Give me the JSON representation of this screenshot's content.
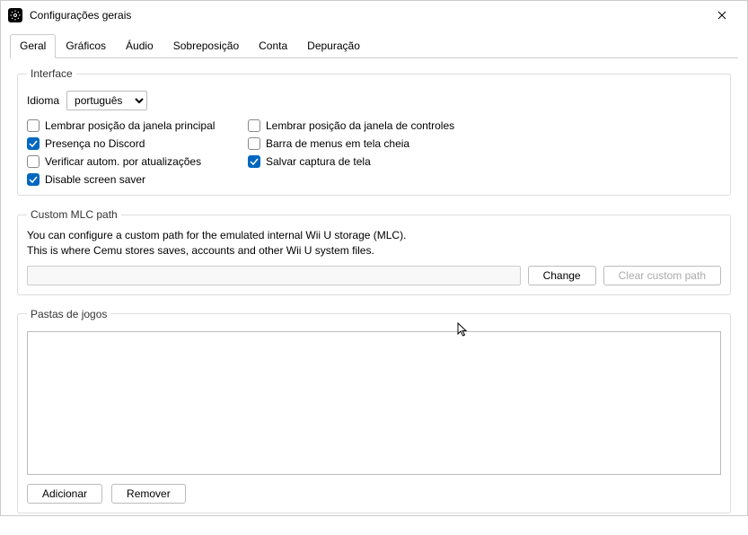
{
  "window": {
    "title": "Configurações gerais"
  },
  "tabs": {
    "items": [
      {
        "label": "Geral",
        "active": true
      },
      {
        "label": "Gráficos",
        "active": false
      },
      {
        "label": "Áudio",
        "active": false
      },
      {
        "label": "Sobreposição",
        "active": false
      },
      {
        "label": "Conta",
        "active": false
      },
      {
        "label": "Depuração",
        "active": false
      }
    ]
  },
  "interface": {
    "legend": "Interface",
    "language_label": "Idioma",
    "language_value": "português",
    "checks": [
      {
        "label": "Lembrar posição da janela principal",
        "checked": false
      },
      {
        "label": "Lembrar posição da janela de controles",
        "checked": false
      },
      {
        "label": "Presença no Discord",
        "checked": true
      },
      {
        "label": "Barra de menus em tela cheia",
        "checked": false
      },
      {
        "label": "Verificar autom. por atualizações",
        "checked": false
      },
      {
        "label": "Salvar captura de tela",
        "checked": true
      },
      {
        "label": "Disable screen saver",
        "checked": true
      }
    ]
  },
  "mlc": {
    "legend": "Custom MLC path",
    "desc1": "You can configure a custom path for the emulated internal Wii U storage (MLC).",
    "desc2": "This is where Cemu stores saves, accounts and other Wii U system files.",
    "path": "",
    "change": "Change",
    "clear": "Clear custom path"
  },
  "games": {
    "legend": "Pastas de jogos",
    "add": "Adicionar",
    "remove": "Remover"
  }
}
